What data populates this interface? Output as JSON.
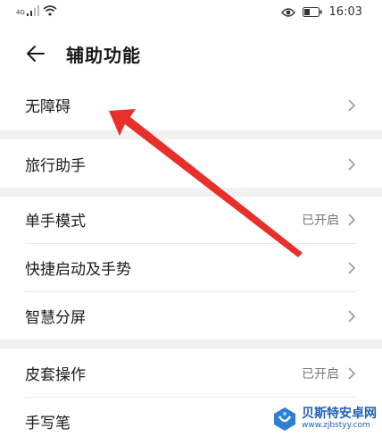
{
  "status_bar": {
    "network": "4G",
    "time": "16:03",
    "icons": [
      "signal-icon",
      "wifi-icon",
      "eye-icon",
      "battery-icon"
    ]
  },
  "header": {
    "title": "辅助功能",
    "back_icon": "back-arrow-icon"
  },
  "menu": [
    {
      "label": "无障碍",
      "value": ""
    },
    {
      "label": "旅行助手",
      "value": ""
    },
    {
      "label": "单手模式",
      "value": "已开启"
    },
    {
      "label": "快捷启动及手势",
      "value": ""
    },
    {
      "label": "智慧分屏",
      "value": ""
    },
    {
      "label": "皮套操作",
      "value": "已开启"
    },
    {
      "label": "手写笔",
      "value": ""
    }
  ],
  "annotation": {
    "color": "#e8302a"
  },
  "watermark": {
    "name": "贝斯特安卓网",
    "url": "www.zjbstyy.com"
  }
}
